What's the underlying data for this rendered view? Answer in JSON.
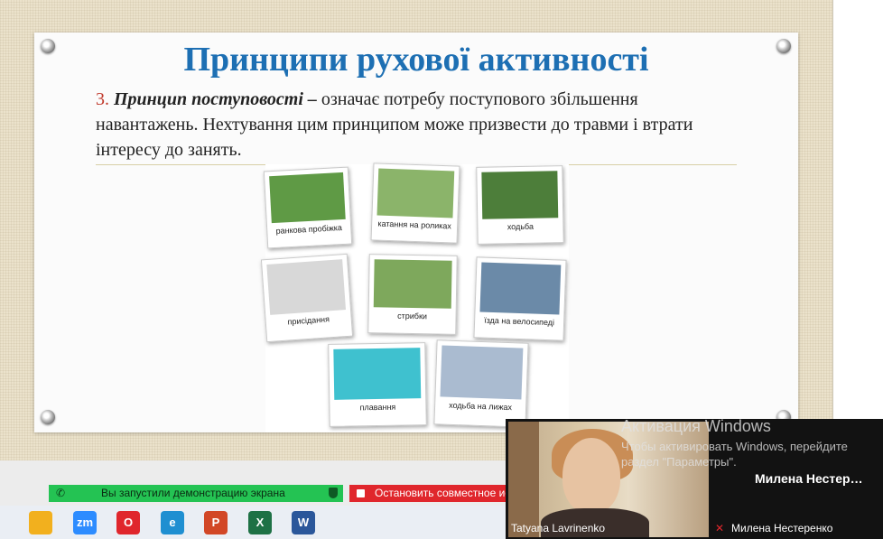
{
  "slide": {
    "title": "Принципи рухової активності",
    "body": {
      "number": "3.",
      "term": "Принцип поступовості",
      "dash": " –",
      "text": " означає потребу поступового збільшення навантажень. Нехтування цим принципом може призвести до травми і втрати інтересу до занять."
    },
    "cards": [
      {
        "label": "ранкова пробіжка",
        "color": "#5f9a45"
      },
      {
        "label": "катання на роликах",
        "color": "#8bb46a"
      },
      {
        "label": "ходьба",
        "color": "#4d7e3a"
      },
      {
        "label": "присідання",
        "color": "#d8d8d8"
      },
      {
        "label": "стрибки",
        "color": "#7ea85c"
      },
      {
        "label": "їзда на велосипеді",
        "color": "#6b8aa8"
      },
      {
        "label": "плавання",
        "color": "#3fc1cf"
      },
      {
        "label": "ходьба на лижах",
        "color": "#aabbd0"
      }
    ]
  },
  "share": {
    "status": "Вы запустили демонстрацию экрана",
    "stop": "Остановить совместное ис"
  },
  "taskbar": {
    "icons": [
      {
        "name": "explorer",
        "label": "",
        "color": "#f2b01e"
      },
      {
        "name": "zoom",
        "label": "zm",
        "color": "#2d8cff"
      },
      {
        "name": "opera",
        "label": "O",
        "color": "#e0262c"
      },
      {
        "name": "edge",
        "label": "e",
        "color": "#1f8fd1"
      },
      {
        "name": "powerpoint",
        "label": "P",
        "color": "#d24726"
      },
      {
        "name": "excel",
        "label": "X",
        "color": "#1e7145"
      },
      {
        "name": "word",
        "label": "W",
        "color": "#2b579a"
      }
    ]
  },
  "video": {
    "participant1": "Tatyana Lavrinenko",
    "participant2_big": "Милена  Нестер…",
    "participant2": "Милена Нестеренко"
  },
  "activation": {
    "line1": "Активация Windows",
    "line2": "Чтобы активировать Windows, перейдите",
    "line3": "раздел \"Параметры\"."
  }
}
